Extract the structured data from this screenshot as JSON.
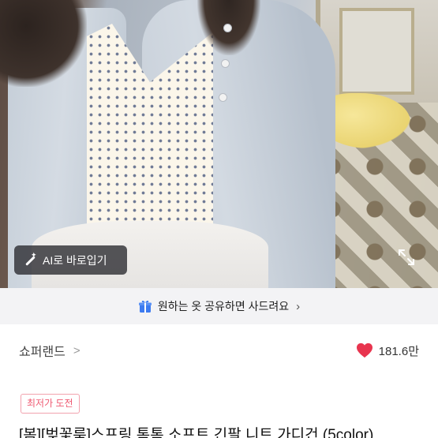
{
  "photo": {
    "ai_button_label": "AI로 바로입기",
    "ai_icon": "magic-wand-icon",
    "expand_icon": "expand-icon"
  },
  "promo": {
    "text": "원하는 옷 공유하면 사드려요",
    "icon": "gift-icon",
    "chevron": "›"
  },
  "store": {
    "name": "쇼퍼랜드",
    "chevron": ">",
    "like_count": "181.6만",
    "heart_color": "#e8344e"
  },
  "product": {
    "badge": "최저가 도전",
    "title": "[봄][벚꽃룩]스프링 톡톡 소프트 긴팔 니트 가디건 (5color)"
  },
  "colors": {
    "badge_text": "#ef5a72",
    "promo_background": "#f3f3f5",
    "gift_icon": "#3d7bf0"
  }
}
